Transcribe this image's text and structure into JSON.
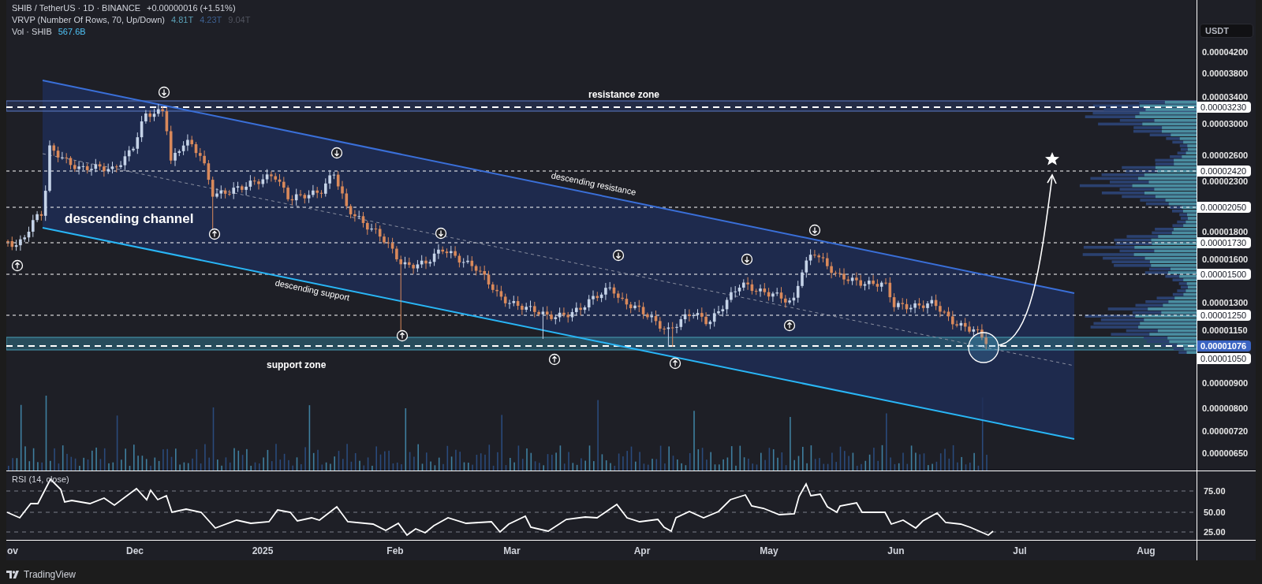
{
  "header": {
    "symbol": "SHIB / TetherUS · 1D · BINANCE",
    "change": "+0.00000016 (+1.51%)",
    "indicators": [
      {
        "name": "VRVP (Number Of Rows, 70, Up/Down)",
        "values": [
          {
            "text": "4.81T",
            "color": "#5a9fb5"
          },
          {
            "text": "4.23T",
            "color": "#3d5f8f"
          },
          {
            "text": "9.04T",
            "color": "#50535e"
          }
        ]
      },
      {
        "name": "Vol · SHIB",
        "values": [
          {
            "text": "567.6B",
            "color": "#4fc3f7"
          }
        ]
      }
    ]
  },
  "annotations": {
    "resistance_zone": "resistance zone",
    "descending_resistance": "descending resistance",
    "descending_channel": "descending channel",
    "descending_support": "descending support",
    "support_zone": "support zone"
  },
  "price_axis": {
    "currency": "USDT",
    "ticks": [
      "0.00004200",
      "0.00003800",
      "0.00003400",
      "0.00003000",
      "0.00002600",
      "0.00002300",
      "0.00001800",
      "0.00001600",
      "0.00001300",
      "0.00001150",
      "0.00000900",
      "0.00000800",
      "0.00000720",
      "0.00000650"
    ],
    "markers": [
      {
        "text": "0.00003230",
        "kind": "level"
      },
      {
        "text": "0.00002420",
        "kind": "level"
      },
      {
        "text": "0.00002050",
        "kind": "level"
      },
      {
        "text": "0.00001730",
        "kind": "level"
      },
      {
        "text": "0.00001500",
        "kind": "level"
      },
      {
        "text": "0.00001250",
        "kind": "level"
      },
      {
        "text": "0.00001076",
        "kind": "last"
      },
      {
        "text": "0.00001050",
        "kind": "level"
      }
    ]
  },
  "rsi": {
    "title": "RSI (14, close)",
    "ticks": [
      "75.00",
      "50.00",
      "25.00"
    ]
  },
  "time_axis": [
    "ov",
    "Dec",
    "2025",
    "Feb",
    "Mar",
    "Apr",
    "May",
    "Jun",
    "Jul",
    "Aug"
  ],
  "footer": {
    "brand": "TradingView"
  }
}
